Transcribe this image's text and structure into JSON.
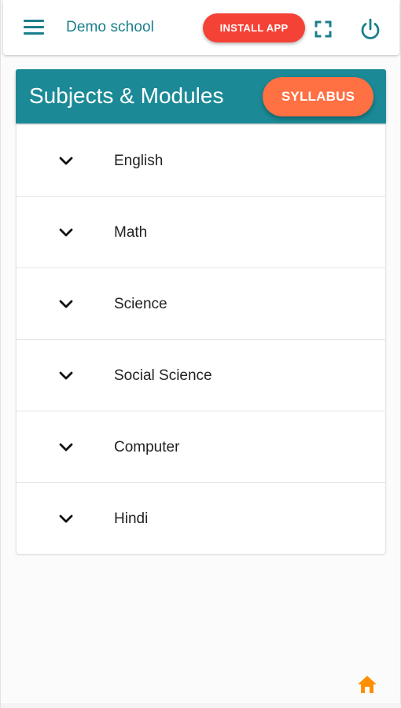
{
  "appbar": {
    "school_name": "Demo school",
    "install_label": "INSTALL APP",
    "icons": {
      "menu": "hamburger-menu-icon",
      "fullscreen": "fullscreen-icon",
      "power": "power-icon"
    },
    "colors": {
      "accent": "#1a7f8c",
      "install": "#f44336"
    }
  },
  "header": {
    "title": "Subjects & Modules",
    "syllabus_label": "SYLLABUS",
    "colors": {
      "background": "#1b8a96",
      "syllabus": "#ff7043"
    }
  },
  "subjects": [
    {
      "label": "English",
      "icon": "chevron-down-icon"
    },
    {
      "label": "Math",
      "icon": "chevron-down-icon"
    },
    {
      "label": "Science",
      "icon": "chevron-down-icon"
    },
    {
      "label": "Social Science",
      "icon": "chevron-down-icon"
    },
    {
      "label": "Computer",
      "icon": "chevron-down-icon"
    },
    {
      "label": "Hindi",
      "icon": "chevron-down-icon"
    }
  ],
  "footer": {
    "home_icon": "home-icon",
    "home_color": "#ff8f00"
  }
}
